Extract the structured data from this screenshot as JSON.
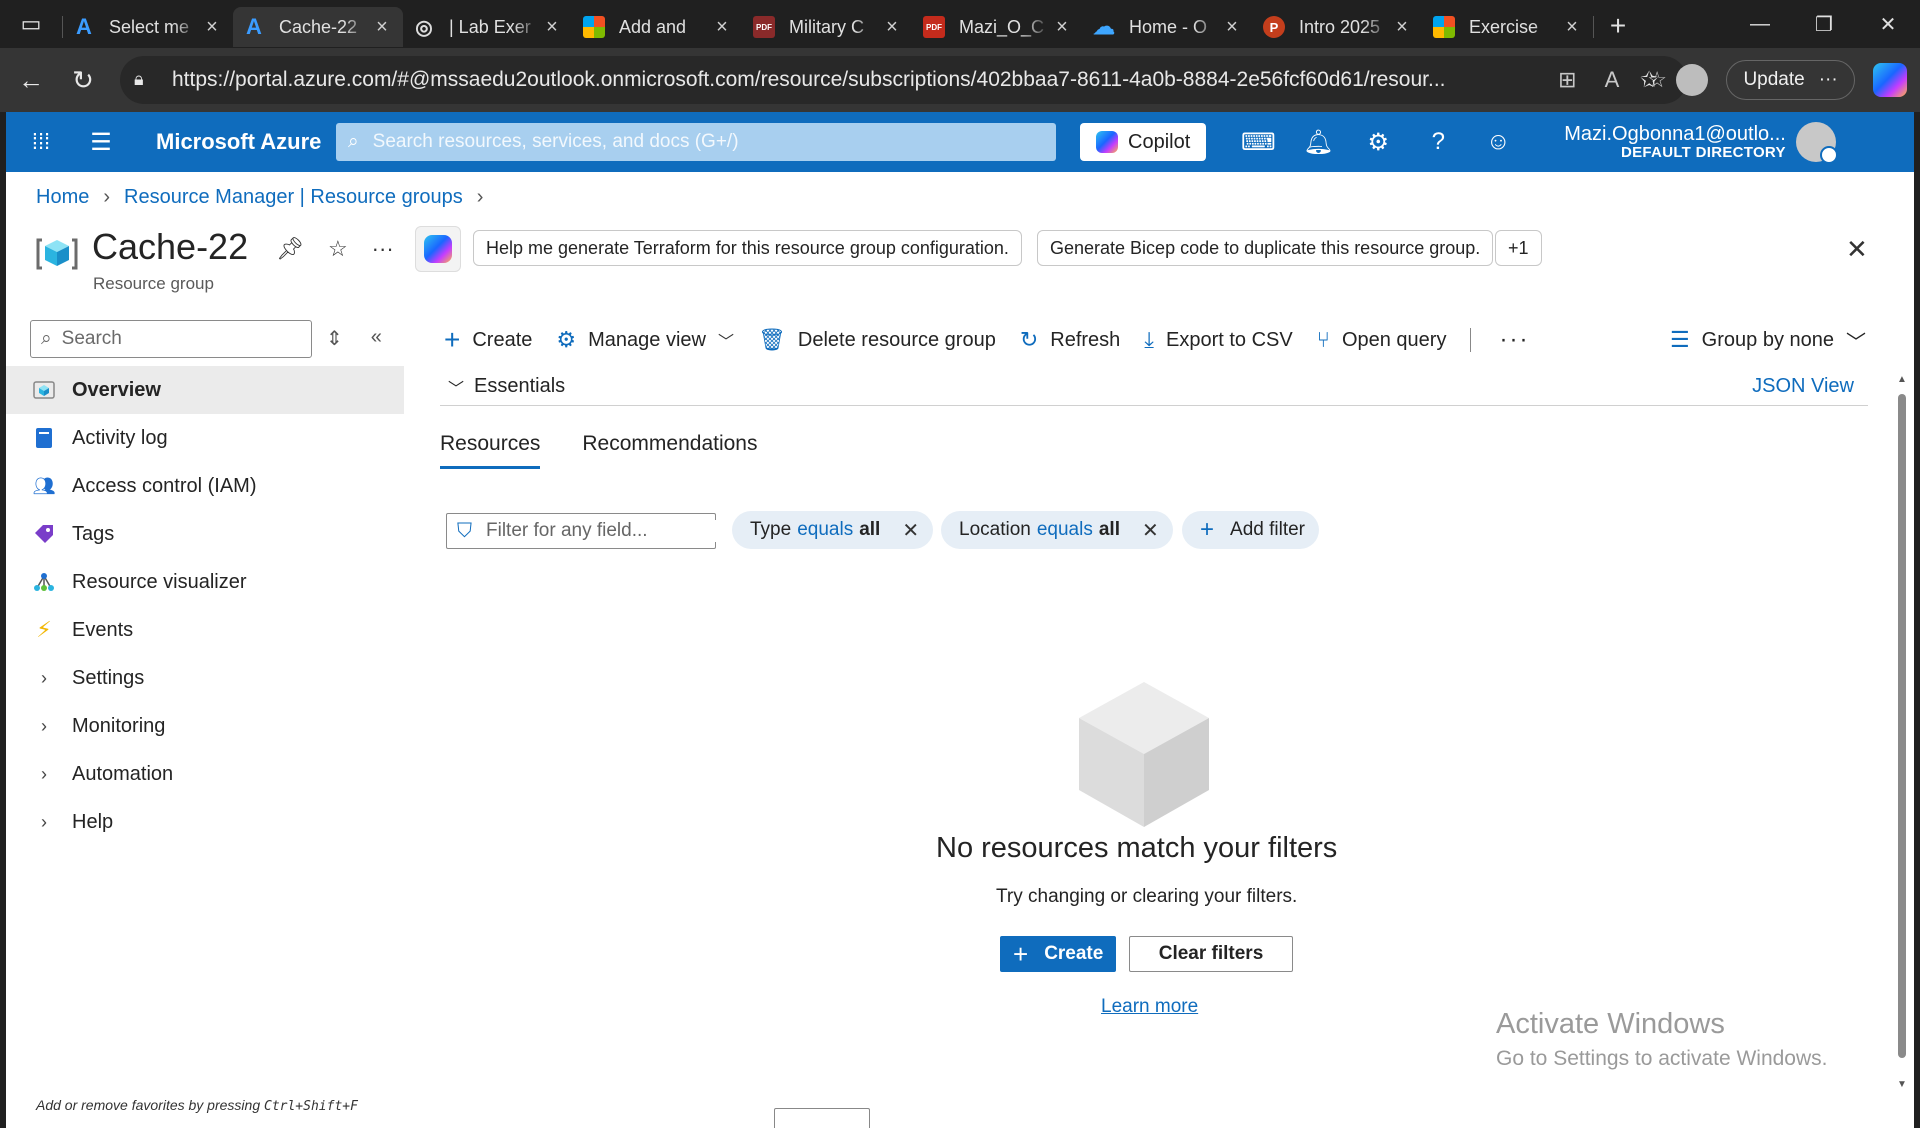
{
  "browser": {
    "tabs": [
      {
        "title": "Select me",
        "icon": "azure-icon",
        "active": false
      },
      {
        "title": "Cache-22",
        "icon": "azure-icon",
        "active": true
      },
      {
        "title": "| Lab Exer",
        "icon": "globe-icon",
        "active": false
      },
      {
        "title": "Add and",
        "icon": "microsoft-icon",
        "active": false
      },
      {
        "title": "Military C",
        "icon": "pdf-icon",
        "active": false
      },
      {
        "title": "Mazi_O_C",
        "icon": "pdf-icon",
        "active": false
      },
      {
        "title": "Home - O",
        "icon": "onedrive-icon",
        "active": false
      },
      {
        "title": "Intro 2025",
        "icon": "powerpoint-icon",
        "active": false
      },
      {
        "title": "Exercise",
        "icon": "microsoft-icon",
        "active": false
      }
    ],
    "url": "https://portal.azure.com/#@mssaedu2outlook.onmicrosoft.com/resource/subscriptions/402bbaa7-8611-4a0b-8884-2e56fcf60d61/resour...",
    "update_label": "Update"
  },
  "portal": {
    "brand": "Microsoft Azure",
    "search_placeholder": "Search resources, services, and docs (G+/)",
    "copilot_label": "Copilot",
    "account_email": "Mazi.Ogbonna1@outlo...",
    "account_directory": "DEFAULT DIRECTORY"
  },
  "breadcrumb": [
    "Home",
    "Resource Manager | Resource groups"
  ],
  "header": {
    "title": "Cache-22",
    "subtitle": "Resource group",
    "suggestions": [
      "Help me generate Terraform for this resource group configuration.",
      "Generate Bicep code to duplicate this resource group.",
      "+1"
    ]
  },
  "nav": {
    "search_placeholder": "Search",
    "items": [
      {
        "label": "Overview",
        "selected": true
      },
      {
        "label": "Activity log"
      },
      {
        "label": "Access control (IAM)"
      },
      {
        "label": "Tags"
      },
      {
        "label": "Resource visualizer"
      },
      {
        "label": "Events"
      },
      {
        "label": "Settings",
        "expandable": true
      },
      {
        "label": "Monitoring",
        "expandable": true
      },
      {
        "label": "Automation",
        "expandable": true
      },
      {
        "label": "Help",
        "expandable": true
      }
    ],
    "favorites_hint_prefix": "Add or remove favorites by pressing ",
    "favorites_hint_keys": "Ctrl+Shift+F"
  },
  "commands": {
    "create": "Create",
    "manage_view": "Manage view",
    "delete": "Delete resource group",
    "refresh": "Refresh",
    "export_csv": "Export to CSV",
    "open_query": "Open query",
    "group_by": "Group by none"
  },
  "essentials": {
    "label": "Essentials",
    "json_view": "JSON View"
  },
  "tabs": [
    {
      "label": "Resources",
      "active": true
    },
    {
      "label": "Recommendations",
      "active": false
    }
  ],
  "filters": {
    "placeholder": "Filter for any field...",
    "type": {
      "field": "Type",
      "op": "equals",
      "value": "all"
    },
    "location": {
      "field": "Location",
      "op": "equals",
      "value": "all"
    },
    "add_filter": "Add filter"
  },
  "empty_state": {
    "title": "No resources match your filters",
    "subtitle": "Try changing or clearing your filters.",
    "create": "Create",
    "clear": "Clear filters",
    "learn_more": "Learn more"
  },
  "watermark": {
    "line1": "Activate Windows",
    "line2": "Go to Settings to activate Windows."
  },
  "colors": {
    "azure_blue": "#0f6cbd",
    "pill_bg": "#e6eef6"
  }
}
